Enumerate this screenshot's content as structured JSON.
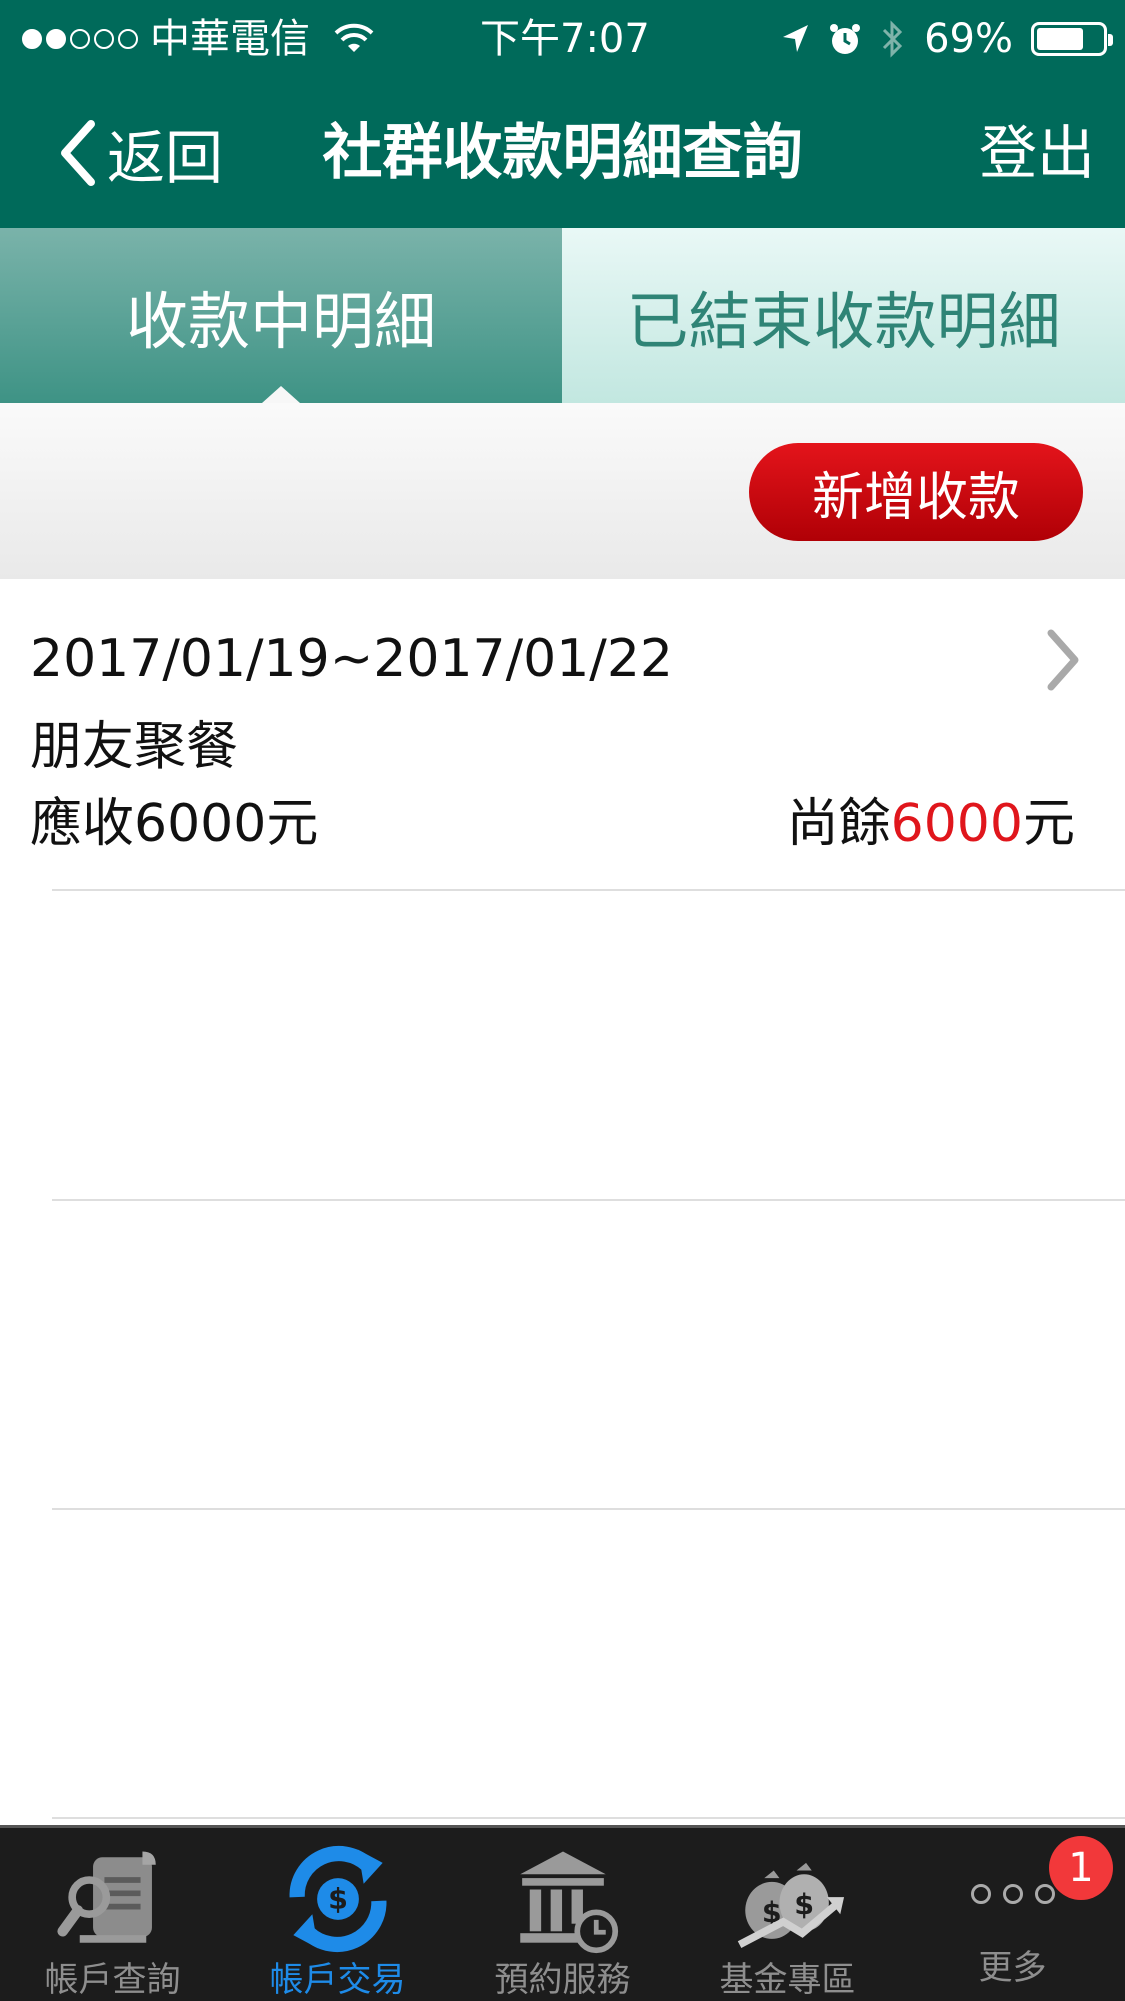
{
  "status": {
    "carrier": "中華電信",
    "time": "下午7:07",
    "battery_pct": "69%"
  },
  "nav": {
    "back_label": "返回",
    "title": "社群收款明細查詢",
    "logout_label": "登出"
  },
  "tabs": {
    "active": "收款中明細",
    "inactive": "已結束收款明細"
  },
  "toolbar": {
    "add_label": "新增收款"
  },
  "list": {
    "items": [
      {
        "date_range": "2017/01/19~2017/01/22",
        "name": "朋友聚餐",
        "receivable_prefix": "應收",
        "receivable_amount": "6000",
        "receivable_unit": "元",
        "remaining_prefix": "尚餘",
        "remaining_amount": "6000",
        "remaining_unit": "元"
      }
    ]
  },
  "tabbar": {
    "items": [
      {
        "label": "帳戶查詢",
        "icon": "account-inquiry-icon"
      },
      {
        "label": "帳戶交易",
        "icon": "account-transaction-icon"
      },
      {
        "label": "預約服務",
        "icon": "reservation-service-icon"
      },
      {
        "label": "基金專區",
        "icon": "fund-zone-icon"
      },
      {
        "label": "更多",
        "icon": "more-icon"
      }
    ],
    "active_index": 1,
    "more_badge": "1"
  },
  "colors": {
    "primary": "#006a5a",
    "accent_red": "#e0161c",
    "tab_active": "#1e8be8"
  }
}
